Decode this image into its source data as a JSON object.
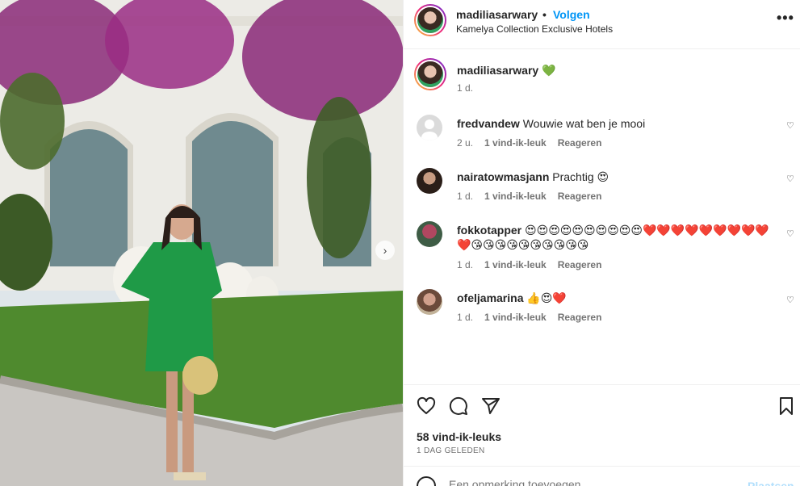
{
  "header": {
    "username": "madiliasarwary",
    "separator": "•",
    "follow_label": "Volgen",
    "location": "Kamelya Collection Exclusive Hotels",
    "more_icon": "more-horizontal-icon",
    "more_label": "•••"
  },
  "caption": {
    "username": "madiliasarwary",
    "text": "💚",
    "time": "1 d."
  },
  "comments": [
    {
      "username": "fredvandew",
      "text": "Wouwie wat ben je mooi",
      "time": "2 u.",
      "likes": "1 vind-ik-leuk",
      "reply": "Reageren",
      "heart": "♡"
    },
    {
      "username": "nairatowmasjann",
      "text": "Prachtig 😍",
      "time": "1 d.",
      "likes": "1 vind-ik-leuk",
      "reply": "Reageren",
      "heart": "♡"
    },
    {
      "username": "fokkotapper",
      "text": "😍😍😍😍😍😍😍😍😍😍❤️❤️❤️❤️❤️❤️❤️❤️❤️❤️😘😘😘😘😘😘😘😘😘😘",
      "time": "1 d.",
      "likes": "1 vind-ik-leuk",
      "reply": "Reageren",
      "heart": "♡"
    },
    {
      "username": "ofeljamarina",
      "text": "👍😍❤️",
      "time": "1 d.",
      "likes": "1 vind-ik-leuk",
      "reply": "Reageren",
      "heart": "♡"
    }
  ],
  "actions": {
    "like_icon": "heart-icon",
    "comment_icon": "comment-icon",
    "share_icon": "share-icon",
    "save_icon": "bookmark-icon",
    "likes_count": "58 vind-ik-leuks",
    "date": "1 DAG GELEDEN"
  },
  "add_comment": {
    "placeholder": "Een opmerking toevoegen...",
    "post_label": "Plaatsen",
    "emoji_icon": "emoji-icon"
  },
  "photo": {
    "next_icon": "chevron-right-icon",
    "next_label": "›"
  },
  "colors": {
    "follow_blue": "#0095f6",
    "text": "#262626",
    "secondary": "#737373",
    "border": "#efefef"
  }
}
